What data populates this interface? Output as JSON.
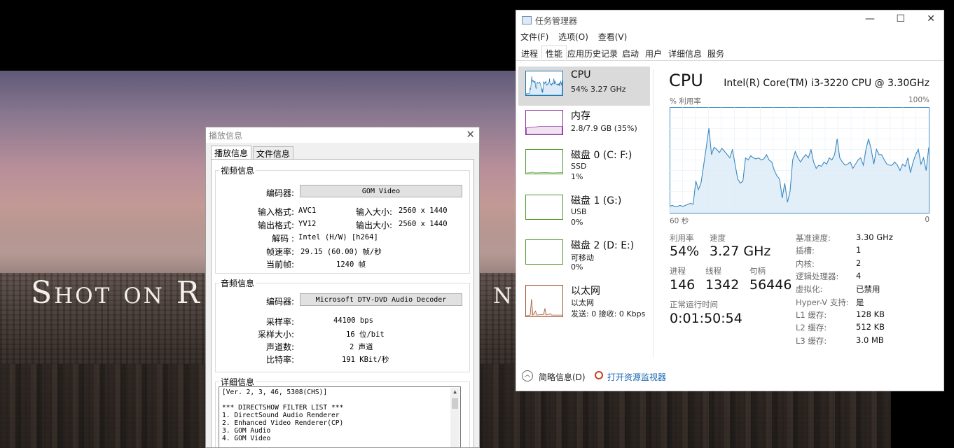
{
  "video": {
    "overlay_text_left": "Shot on R",
    "overlay_text_right": "nd"
  },
  "gom": {
    "title": "播放信息",
    "tabs": [
      "播放信息",
      "文件信息"
    ],
    "video_group": "视频信息",
    "codec_label": "编码器:",
    "codec_value": "GOM Video",
    "in_format_label": "输入格式:",
    "in_format_value": "AVC1",
    "in_size_label": "输入大小:",
    "in_size_value": "2560 x 1440",
    "out_format_label": "输出格式:",
    "out_format_value": "YV12",
    "out_size_label": "输出大小:",
    "out_size_value": "2560 x 1440",
    "decode_label": "解码 :",
    "decode_value": "Intel (H/W) [h264]",
    "fps_label": "帧速率:",
    "fps_value": "29.15 (60.00) 帧/秒",
    "frame_label": "当前帧:",
    "frame_value": "1240 帧",
    "audio_group": "音频信息",
    "acodec_label": "编码器:",
    "acodec_value": "Microsoft DTV-DVD Audio Decoder",
    "sample_rate_label": "采样率:",
    "sample_rate_value": "44100 bps",
    "sample_size_label": "采样大小:",
    "sample_size_value": "16 位/bit",
    "channels_label": "声道数:",
    "channels_value": "2 声道",
    "bitrate_label": "比特率:",
    "bitrate_value": "191 KBit/秒",
    "detail_group": "详细信息",
    "detail_lines": [
      "[Ver. 2, 3, 46, 5308(CHS)]",
      "",
      "*** DIRECTSHOW FILTER LIST ***",
      "1. DirectSound Audio Renderer",
      "2. Enhanced Video Renderer(CP)",
      "3. GOM Audio",
      "4. GOM Video"
    ]
  },
  "tm": {
    "title": "任务管理器",
    "menu": [
      "文件(F)",
      "选项(O)",
      "查看(V)"
    ],
    "tabs": [
      "进程",
      "性能",
      "应用历史记录",
      "启动",
      "用户",
      "详细信息",
      "服务"
    ],
    "side": [
      {
        "name": "CPU",
        "sub1": "54% 3.27 GHz",
        "sub2": "",
        "color": "#1f77b4"
      },
      {
        "name": "内存",
        "sub1": "2.8/7.9 GB (35%)",
        "sub2": "",
        "color": "#8b2fa0"
      },
      {
        "name": "磁盘 0 (C: F:)",
        "sub1": "SSD",
        "sub2": "1%",
        "color": "#4c9a2a"
      },
      {
        "name": "磁盘 1 (G:)",
        "sub1": "USB",
        "sub2": "0%",
        "color": "#4c9a2a"
      },
      {
        "name": "磁盘 2 (D: E:)",
        "sub1": "可移动",
        "sub2": "0%",
        "color": "#4c9a2a"
      },
      {
        "name": "以太网",
        "sub1": "以太网",
        "sub2": "发送: 0 接收: 0 Kbps",
        "color": "#a0522d"
      }
    ],
    "cpu_title": "CPU",
    "cpu_model": "Intel(R) Core(TM) i3-3220 CPU @ 3.30GHz",
    "util_caption": "% 利用率",
    "max_caption": "100%",
    "time_caption": "60 秒",
    "zero_caption": "0",
    "stats": {
      "util_label": "利用率",
      "util_value": "54%",
      "speed_label": "速度",
      "speed_value": "3.27 GHz",
      "proc_label": "进程",
      "proc_value": "146",
      "thread_label": "线程",
      "thread_value": "1342",
      "handle_label": "句柄",
      "handle_value": "56446",
      "uptime_label": "正常运行时间",
      "uptime_value": "0:01:50:54"
    },
    "specs": [
      [
        "基准速度:",
        "3.30 GHz"
      ],
      [
        "插槽:",
        "1"
      ],
      [
        "内核:",
        "2"
      ],
      [
        "逻辑处理器:",
        "4"
      ],
      [
        "虚拟化:",
        "已禁用"
      ],
      [
        "Hyper-V 支持:",
        "是"
      ],
      [
        "L1 缓存:",
        "128 KB"
      ],
      [
        "L2 缓存:",
        "512 KB"
      ],
      [
        "L3 缓存:",
        "3.0 MB"
      ]
    ],
    "footer_brief": "简略信息(D)",
    "footer_monitor": "打开资源监视器",
    "cpu_history": [
      6,
      7,
      6,
      6,
      7,
      6,
      7,
      8,
      9,
      8,
      30,
      22,
      28,
      45,
      62,
      80,
      55,
      62,
      60,
      57,
      61,
      58,
      55,
      52,
      60,
      46,
      32,
      28,
      30,
      52,
      50,
      54,
      52,
      51,
      52,
      50,
      51,
      55,
      50,
      48,
      40,
      35,
      32,
      14,
      28,
      10,
      20,
      50,
      58,
      52,
      48,
      52,
      55,
      52,
      60,
      48,
      42,
      45,
      44,
      48,
      46,
      52,
      50,
      55,
      70,
      52,
      48,
      45,
      46,
      48,
      42,
      46,
      50,
      52,
      45,
      60,
      70,
      60,
      46,
      60,
      55,
      55,
      50,
      46,
      45,
      45,
      48,
      45,
      40,
      46,
      44,
      52,
      38,
      48,
      55,
      60,
      46,
      52,
      40,
      62
    ]
  }
}
